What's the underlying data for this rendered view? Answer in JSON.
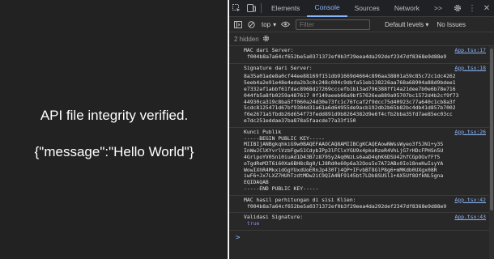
{
  "app": {
    "status_text": "API file integrity verified.",
    "response_text": "{\"message\":\"Hello World\"}"
  },
  "devtools": {
    "tabs": [
      "Elements",
      "Console",
      "Sources",
      "Network",
      ">>"
    ],
    "active_tab": "Console",
    "toolbar": {
      "context": "top",
      "filter_placeholder": "Filter",
      "levels": "Default levels",
      "issues": "No Issues"
    },
    "hidden_label": "2 hidden",
    "logs": [
      {
        "label": "MAC dari Server:",
        "source": "App.tsx:17",
        "body": "f004b8a7a64cf652be5a0371372ef0b3f29eea4da292def2347df8368e9d88e9"
      },
      {
        "label": "Signature dari Server:",
        "source": "App.tsx:18",
        "body": "8a35a01ade8a0cf44ee88169f151db91669d4664c896aa38801a59c85c72c1dc4262\n5eeb4a2e91e48e4eda2b3c0c248c004c9dbfa51eb138226aa768a68904a88d9bdee1\ne7332af1abbf61fdac8968d27269cccefb1b13ad796388ff14a21dee7b0e6b78e716\n044fb5a8fb0259a487617 0f149aeeb66a9bf57626ea889a95707bc1572d4b2cf9f73\n44930ca319c8ba5ff060a24d30e73fc1c76fcaf2f9dcc75d40923c77a640c1cb8a3f\n5cdc8125471d67bf9384d31a61a6d64955de9acb192db2b65b82bc4db41d857b7002\nf6e2671a5fbdb26d654f73fedd891d9b8264382d9e6f4cfb2bba35fd7ae85ec03cc\ne7dc251eddae37ba878a5faacde77a33f150"
      },
      {
        "label": "Kunci Publik",
        "source": "App.tsx:26",
        "body": "-----BEGIN PUBLIC KEY-----\nMIIBIjANBgkqhkiG9w0BAQEFAAOCAQ8AMIIBCgKCAQEAowNWssWyeo3f5JN1+y3S\nInWwJClKYvrlVzbFgwS1CdybIPp3lFClxYGU9x4pkxRzeR4VhLjG7rHDcFPHSn5U\n4GrlpoYV0Sn10iuAd1D43B7z8795y2Aq0NzLs6aaD4qhK6DSU42hfCGpOGvfFf5\noTgdReM3T6i60Xa6BH8cBg0/LJ8Rd0e60p6a32Oos5o7A72ABx0Io18neKwIsyYA\nWowIXhR4MkxidGgYUxdUoERnJp430Tj4QP+IFvbBT8GlP8g6+mMKdb0UXgx08R\niwF6+Jx7LXZ7HUhTzdtMDw2iC9QIA4NF9145bt7LDb8SUSl1+AX5Uf8OfkNL5gna\nEQIDAQAB\n-----END PUBLIC KEY-----"
      },
      {
        "label": "MAC hasil perhitungan di sisi Klien:",
        "source": "App.tsx:42",
        "body": "f004b8a7a64cf652be5a0371372ef0b3f29eea4da292def2347df8368e9d88e9"
      },
      {
        "label": "Validasi Signature:",
        "source": "App.tsx:43",
        "value": "true"
      }
    ],
    "prompt": ">"
  }
}
